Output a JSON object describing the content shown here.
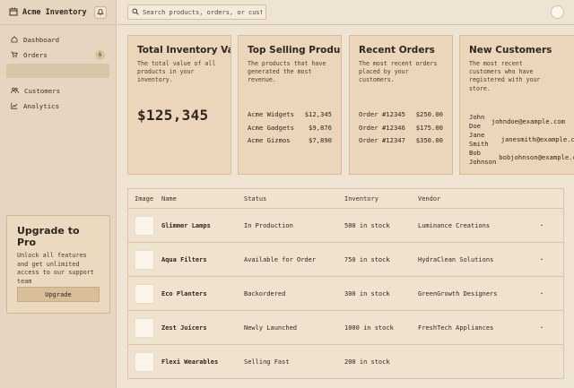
{
  "app": {
    "title": "Acme Inventory"
  },
  "nav": {
    "items": [
      {
        "label": "Dashboard",
        "icon": "home-icon"
      },
      {
        "label": "Orders",
        "icon": "cart-icon",
        "badge": "6"
      },
      {
        "label": "Customers",
        "icon": "users-icon"
      },
      {
        "label": "Analytics",
        "icon": "chart-icon"
      }
    ]
  },
  "upgrade": {
    "title": "Upgrade to Pro",
    "text": "Unlock all features and get unlimited access to our support team",
    "button": "Upgrade"
  },
  "search": {
    "placeholder": "Search products, orders, or customers..."
  },
  "cards": {
    "inventory": {
      "title": "Total Inventory Value",
      "desc": "The total value of all products in your inventory.",
      "value": "$125,345"
    },
    "top_selling": {
      "title": "Top Selling Products",
      "desc": "The products that have generated the most revenue.",
      "items": [
        {
          "name": "Acme Widgets",
          "value": "$12,345"
        },
        {
          "name": "Acme Gadgets",
          "value": "$9,876"
        },
        {
          "name": "Acme Gizmos",
          "value": "$7,890"
        }
      ]
    },
    "recent_orders": {
      "title": "Recent Orders",
      "desc": "The most recent orders placed by your customers.",
      "items": [
        {
          "id": "Order #12345",
          "value": "$250.00"
        },
        {
          "id": "Order #12346",
          "value": "$175.00"
        },
        {
          "id": "Order #12347",
          "value": "$350.00"
        }
      ]
    },
    "new_customers": {
      "title": "New Customers",
      "desc": "The most recent customers who have registered with your store.",
      "items": [
        {
          "name": "John Doe",
          "email": "johndoe@example.com"
        },
        {
          "name": "Jane Smith",
          "email": "janesmith@example.com"
        },
        {
          "name": "Bob Johnson",
          "email": "bobjohnson@example.com"
        }
      ]
    }
  },
  "table": {
    "headers": {
      "image": "Image",
      "name": "Name",
      "status": "Status",
      "inventory": "Inventory",
      "vendor": "Vendor"
    },
    "rows": [
      {
        "name": "Glimmer Lamps",
        "status": "In Production",
        "inventory": "500 in stock",
        "vendor": "Luminance Creations",
        "action": "·"
      },
      {
        "name": "Aqua Filters",
        "status": "Available for Order",
        "inventory": "750 in stock",
        "vendor": "HydraClean Solutions",
        "action": "·"
      },
      {
        "name": "Eco Planters",
        "status": "Backordered",
        "inventory": "300 in stock",
        "vendor": "GreenGrowth Designers",
        "action": "·"
      },
      {
        "name": "Zest Juicers",
        "status": "Newly Launched",
        "inventory": "1000 in stock",
        "vendor": "FreshTech Appliances",
        "action": "·"
      },
      {
        "name": "Flexi Wearables",
        "status": "Selling Fast",
        "inventory": "200 in stock",
        "vendor": "",
        "action": ""
      }
    ]
  }
}
